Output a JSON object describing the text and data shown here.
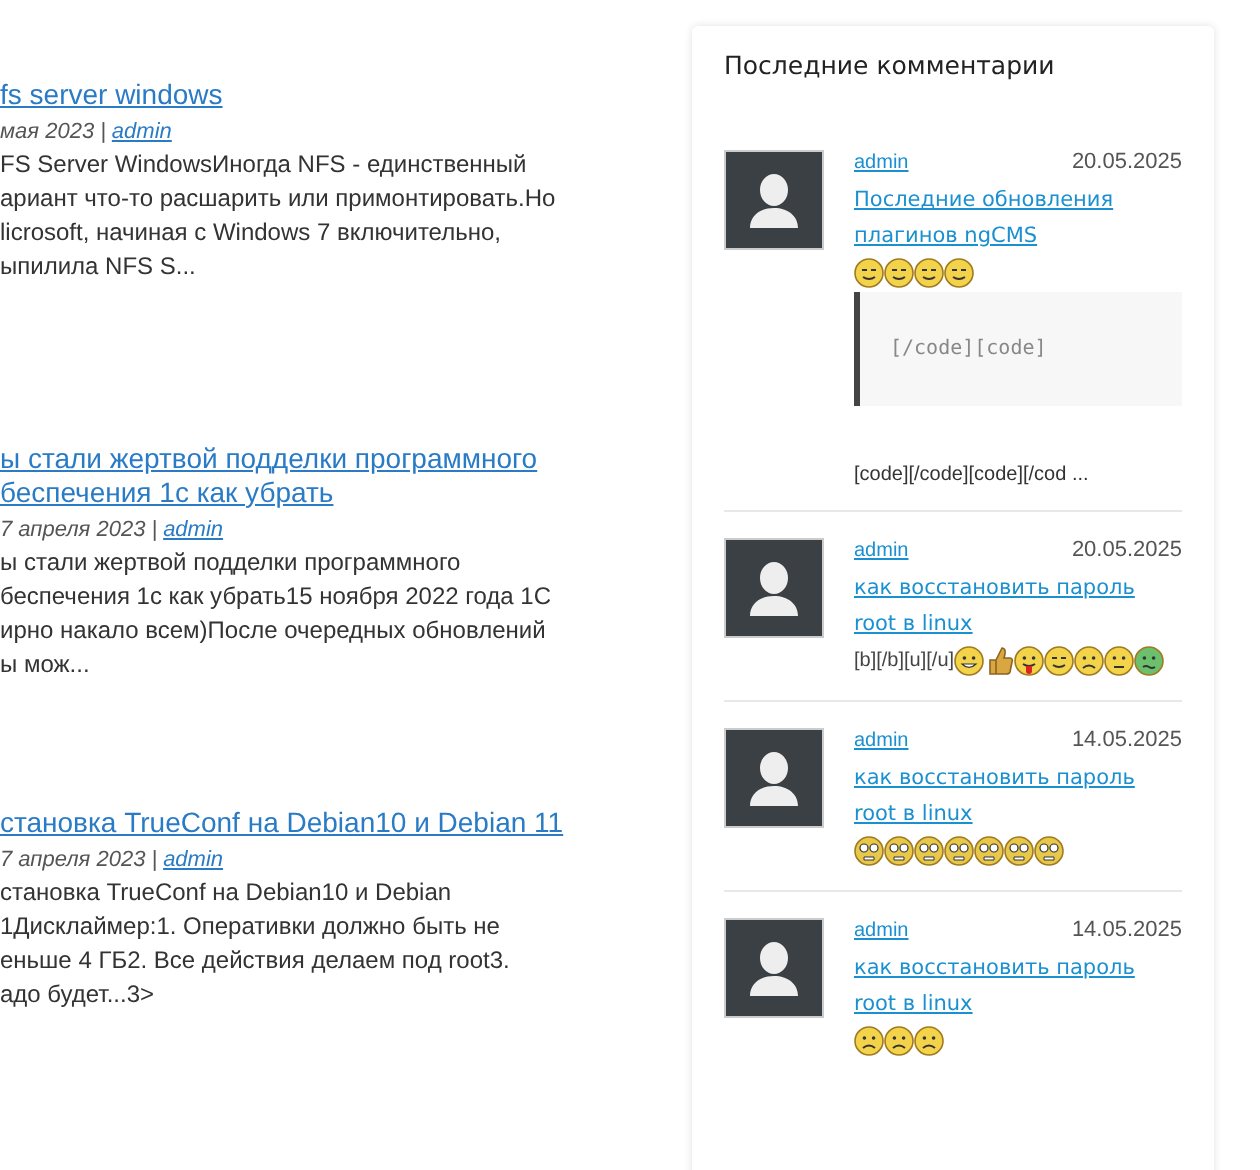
{
  "articles": [
    {
      "title": "fs server windows",
      "date": "мая 2023",
      "separator": "|",
      "author": "admin",
      "excerpt": "FS Server WindowsИногда NFS - единственный\nариант что-то расшарить или примонтировать.Но\nlicrosoft, начиная с Windows 7 включительно,\nыпилила NFS S..."
    },
    {
      "title": "ы стали жертвой подделки программного\nбеспечения 1с как убрать",
      "date": "7 апреля 2023",
      "separator": "|",
      "author": "admin",
      "excerpt": "ы стали жертвой подделки программного\nбеспечения 1с как убрать15 ноября 2022 года 1С\nирно накало всем)После очередных обновлений\nы мож..."
    },
    {
      "title": "становка TrueConf на Debian10 и Debian 11",
      "date": "7 апреля 2023",
      "separator": "|",
      "author": "admin",
      "excerpt": "становка TrueConf на Debian10 и Debian\n1Дисклаймер:1. Оперативки должно быть не\nеньше 4 ГБ2. Все действия делаем под root3.\nадо будет...3>"
    }
  ],
  "sidebar": {
    "title": "Последние комментарии",
    "comments": [
      {
        "author": "admin",
        "date": "20.05.2025",
        "post": "Последние обновления плагинов ngCMS",
        "smileys": [
          {
            "kind": "wink"
          },
          {
            "kind": "wink"
          },
          {
            "kind": "wink"
          },
          {
            "kind": "wink"
          }
        ],
        "code": "[/code][code]",
        "after": "[code][/code][code][/cod ..."
      },
      {
        "author": "admin",
        "date": "20.05.2025",
        "post": "как восстановить пароль root в linux",
        "prefix": "[b][/b][u][/u]",
        "smileys": [
          {
            "kind": "grin"
          },
          {
            "kind": "thumb"
          },
          {
            "kind": "tongue"
          },
          {
            "kind": "wink"
          },
          {
            "kind": "sad"
          },
          {
            "kind": "neutral"
          },
          {
            "kind": "sick"
          }
        ]
      },
      {
        "author": "admin",
        "date": "14.05.2025",
        "post": "как восстановить пароль root в linux",
        "smileys": [
          {
            "kind": "crazy"
          },
          {
            "kind": "crazy"
          },
          {
            "kind": "crazy"
          },
          {
            "kind": "crazy"
          },
          {
            "kind": "crazy"
          },
          {
            "kind": "crazy"
          },
          {
            "kind": "crazy"
          }
        ]
      },
      {
        "author": "admin",
        "date": "14.05.2025",
        "post": "как восстановить пароль root в linux",
        "smileys": [
          {
            "kind": "sad"
          },
          {
            "kind": "sad"
          },
          {
            "kind": "sad"
          }
        ]
      }
    ]
  }
}
